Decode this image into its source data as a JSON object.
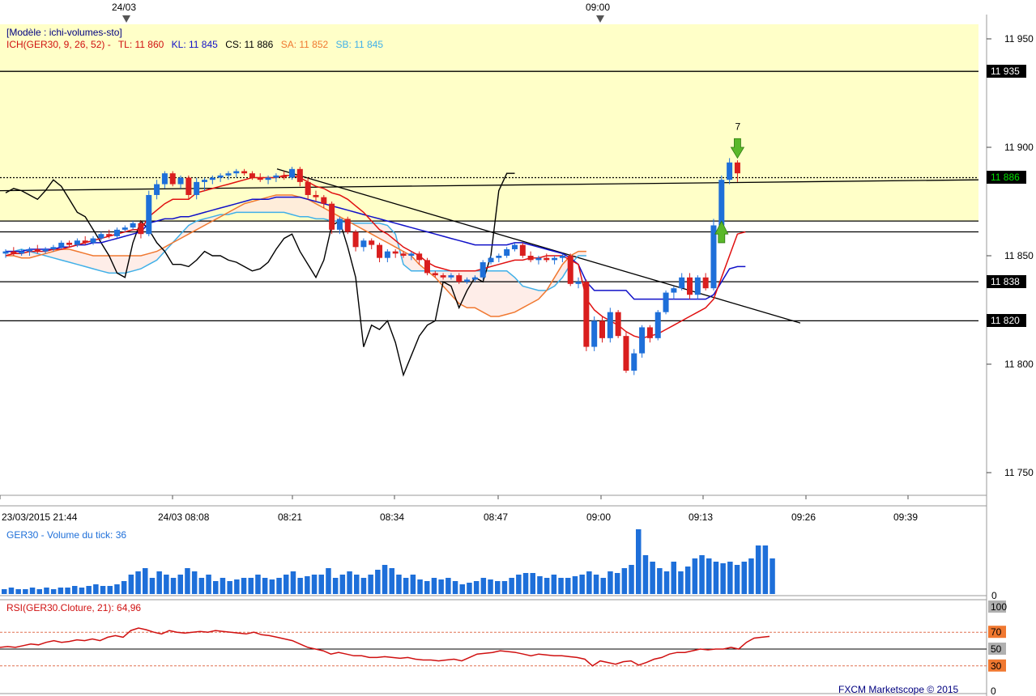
{
  "header": {
    "date_marker": "24/03",
    "time_marker": "09:00"
  },
  "legend": {
    "template": "[Modèle : ichi-volumes-sto]",
    "ich": "ICH(GER30, 9, 26, 52) -",
    "tl": "TL: 11 860",
    "kl": "KL: 11 845",
    "cs": "CS: 11 886",
    "sa": "SA: 11 852",
    "sb": "SB: 11 845"
  },
  "price_axis": {
    "ticks": [
      "11 950",
      "11 900",
      "11 850",
      "11 800",
      "11 750"
    ],
    "tick_values": [
      11950,
      11900,
      11850,
      11800,
      11750
    ],
    "label_11935": "11 935",
    "label_11886": "11 886",
    "label_11838": "11 838",
    "label_11820": "11 820"
  },
  "time_axis": {
    "labels": [
      "23/03/2015 21:44",
      "24/03 08:08",
      "08:21",
      "08:34",
      "08:47",
      "09:00",
      "09:13",
      "09:26",
      "09:39"
    ]
  },
  "volume_panel": {
    "title": "GER30 - Volume du tick: 36",
    "zero_label": "0"
  },
  "rsi_panel": {
    "title": "RSI(GER30.Cloture, 21): 64,96",
    "levels": [
      "100",
      "70",
      "50",
      "30",
      "0"
    ]
  },
  "footer": {
    "copyright": "FXCM Marketscope © 2015"
  },
  "signal": {
    "count_label": "7"
  },
  "colors": {
    "bull": "#1e6fd9",
    "bear": "#d91e1e",
    "tenkan": "#e01010",
    "kijun": "#1010c8",
    "chikou": "#000000",
    "senkou_a": "#f07830",
    "senkou_b": "#40b0e8",
    "highlight_zone": "#ffffc8"
  },
  "chart_data": [
    {
      "type": "candlestick",
      "title": "ICH(GER30, 9, 26, 52)",
      "ylim": [
        11740,
        11960
      ],
      "horizontal_levels": [
        11935,
        11866,
        11861,
        11838,
        11820
      ],
      "current_price": 11886,
      "ohlc": [
        [
          11851,
          11853,
          11849,
          11852
        ],
        [
          11852,
          11854,
          11850,
          11851
        ],
        [
          11851,
          11853,
          11850,
          11852
        ],
        [
          11852,
          11854,
          11850,
          11853
        ],
        [
          11853,
          11855,
          11851,
          11852
        ],
        [
          11852,
          11854,
          11851,
          11853
        ],
        [
          11853,
          11855,
          11852,
          11854
        ],
        [
          11854,
          11857,
          11853,
          11856
        ],
        [
          11856,
          11857,
          11854,
          11855
        ],
        [
          11855,
          11858,
          11854,
          11857
        ],
        [
          11857,
          11859,
          11855,
          11856
        ],
        [
          11856,
          11859,
          11855,
          11858
        ],
        [
          11858,
          11861,
          11857,
          11860
        ],
        [
          11860,
          11862,
          11858,
          11859
        ],
        [
          11859,
          11863,
          11858,
          11862
        ],
        [
          11862,
          11864,
          11861,
          11863
        ],
        [
          11863,
          11866,
          11862,
          11865
        ],
        [
          11865,
          11866,
          11858,
          11860
        ],
        [
          11860,
          11880,
          11859,
          11878
        ],
        [
          11878,
          11885,
          11876,
          11883
        ],
        [
          11883,
          11889,
          11881,
          11888
        ],
        [
          11888,
          11889,
          11882,
          11883
        ],
        [
          11883,
          11887,
          11881,
          11886
        ],
        [
          11886,
          11887,
          11876,
          11878
        ],
        [
          11878,
          11886,
          11876,
          11884
        ],
        [
          11884,
          11886,
          11880,
          11885
        ],
        [
          11885,
          11887,
          11883,
          11886
        ],
        [
          11886,
          11888,
          11884,
          11887
        ],
        [
          11887,
          11889,
          11885,
          11888
        ],
        [
          11888,
          11890,
          11886,
          11889
        ],
        [
          11889,
          11890,
          11887,
          11888
        ],
        [
          11888,
          11889,
          11885,
          11886
        ],
        [
          11886,
          11888,
          11884,
          11885
        ],
        [
          11885,
          11887,
          11883,
          11886
        ],
        [
          11886,
          11888,
          11884,
          11887
        ],
        [
          11887,
          11889,
          11885,
          11886
        ],
        [
          11886,
          11891,
          11885,
          11890
        ],
        [
          11890,
          11891,
          11882,
          11884
        ],
        [
          11884,
          11886,
          11876,
          11878
        ],
        [
          11878,
          11880,
          11875,
          11877
        ],
        [
          11877,
          11878,
          11872,
          11874
        ],
        [
          11874,
          11875,
          11860,
          11862
        ],
        [
          11862,
          11868,
          11860,
          11867
        ],
        [
          11867,
          11868,
          11860,
          11861
        ],
        [
          11861,
          11862,
          11852,
          11854
        ],
        [
          11854,
          11858,
          11852,
          11857
        ],
        [
          11857,
          11858,
          11853,
          11855
        ],
        [
          11855,
          11856,
          11847,
          11849
        ],
        [
          11849,
          11853,
          11847,
          11852
        ],
        [
          11852,
          11853,
          11849,
          11851
        ],
        [
          11851,
          11852,
          11849,
          11850
        ],
        [
          11850,
          11852,
          11848,
          11851
        ],
        [
          11851,
          11852,
          11846,
          11848
        ],
        [
          11848,
          11849,
          11841,
          11842
        ],
        [
          11842,
          11843,
          11840,
          11841
        ],
        [
          11841,
          11842,
          11839,
          11840
        ],
        [
          11840,
          11842,
          11839,
          11841
        ],
        [
          11841,
          11842,
          11837,
          11838
        ],
        [
          11838,
          11840,
          11837,
          11839
        ],
        [
          11839,
          11841,
          11838,
          11840
        ],
        [
          11840,
          11848,
          11839,
          11847
        ],
        [
          11847,
          11850,
          11846,
          11849
        ],
        [
          11849,
          11851,
          11847,
          11850
        ],
        [
          11850,
          11854,
          11849,
          11853
        ],
        [
          11853,
          11856,
          11852,
          11855
        ],
        [
          11855,
          11856,
          11849,
          11850
        ],
        [
          11850,
          11852,
          11847,
          11848
        ],
        [
          11848,
          11850,
          11846,
          11849
        ],
        [
          11849,
          11851,
          11847,
          11848
        ],
        [
          11848,
          11850,
          11846,
          11849
        ],
        [
          11849,
          11851,
          11847,
          11850
        ],
        [
          11850,
          11851,
          11836,
          11837
        ],
        [
          11837,
          11840,
          11835,
          11838
        ],
        [
          11838,
          11839,
          11806,
          11808
        ],
        [
          11808,
          11822,
          11806,
          11820
        ],
        [
          11820,
          11822,
          11810,
          11812
        ],
        [
          11812,
          11826,
          11810,
          11824
        ],
        [
          11824,
          11825,
          11812,
          11813
        ],
        [
          11813,
          11815,
          11796,
          11797
        ],
        [
          11797,
          11807,
          11795,
          11805
        ],
        [
          11805,
          11818,
          11803,
          11817
        ],
        [
          11817,
          11818,
          11810,
          11812
        ],
        [
          11812,
          11825,
          11811,
          11824
        ],
        [
          11824,
          11834,
          11823,
          11833
        ],
        [
          11833,
          11836,
          11830,
          11835
        ],
        [
          11835,
          11842,
          11834,
          11840
        ],
        [
          11840,
          11842,
          11830,
          11832
        ],
        [
          11832,
          11841,
          11830,
          11840
        ],
        [
          11840,
          11842,
          11834,
          11835
        ],
        [
          11835,
          11867,
          11834,
          11864
        ],
        [
          11864,
          11887,
          11862,
          11885
        ],
        [
          11885,
          11895,
          11883,
          11893
        ],
        [
          11893,
          11894,
          11884,
          11888
        ]
      ],
      "tenkan": [
        11850,
        11851,
        11851,
        11852,
        11852,
        11852,
        11853,
        11853,
        11854,
        11855,
        11856,
        11857,
        11858,
        11859,
        11860,
        11861,
        11862,
        11862,
        11868,
        11871,
        11874,
        11876,
        11876,
        11876,
        11879,
        11880,
        11881,
        11882,
        11883,
        11884,
        11885,
        11886,
        11886,
        11886,
        11886,
        11887,
        11887,
        11886,
        11884,
        11882,
        11881,
        11879,
        11878,
        11876,
        11873,
        11870,
        11866,
        11862,
        11860,
        11857,
        11854,
        11852,
        11850,
        11847,
        11845,
        11844,
        11843,
        11843,
        11843,
        11843,
        11844,
        11845,
        11846,
        11847,
        11848,
        11848,
        11849,
        11849,
        11850,
        11850,
        11850,
        11848,
        11846,
        11830,
        11825,
        11822,
        11820,
        11818,
        11815,
        11813,
        11812,
        11813,
        11814,
        11816,
        11818,
        11820,
        11822,
        11824,
        11826,
        11830,
        11840,
        11850,
        11860,
        11861
      ],
      "kijun": [
        11852,
        11852,
        11852,
        11853,
        11853,
        11853,
        11853,
        11854,
        11854,
        11855,
        11855,
        11856,
        11856,
        11857,
        11858,
        11859,
        11860,
        11861,
        11865,
        11866,
        11867,
        11867,
        11868,
        11868,
        11869,
        11870,
        11871,
        11872,
        11873,
        11874,
        11875,
        11876,
        11876,
        11876,
        11877,
        11877,
        11877,
        11877,
        11876,
        11875,
        11874,
        11873,
        11872,
        11871,
        11870,
        11869,
        11868,
        11867,
        11866,
        11865,
        11864,
        11863,
        11862,
        11861,
        11860,
        11859,
        11858,
        11857,
        11856,
        11855,
        11855,
        11855,
        11855,
        11855,
        11856,
        11856,
        11855,
        11854,
        11853,
        11852,
        11851,
        11849,
        11846,
        11838,
        11834,
        11834,
        11834,
        11834,
        11834,
        11830,
        11830,
        11830,
        11830,
        11830,
        11830,
        11830,
        11830,
        11830,
        11830,
        11832,
        11838,
        11844,
        11845,
        11845
      ],
      "senkou_a": [
        11850,
        11850,
        11849,
        11849,
        11850,
        11851,
        11852,
        11853,
        11853,
        11852,
        11851,
        11850,
        11850,
        11850,
        11850,
        11850,
        11850,
        11850,
        11851,
        11852,
        11854,
        11856,
        11858,
        11860,
        11862,
        11864,
        11866,
        11868,
        11870,
        11872,
        11874,
        11875,
        11876,
        11877,
        11878,
        11878,
        11878,
        11877,
        11876,
        11874,
        11872,
        11870,
        11868,
        11866,
        11864,
        11862,
        11860,
        11858,
        11856,
        11854,
        11852,
        11850,
        11846,
        11843,
        11840,
        11836,
        11832,
        11828,
        11826,
        11826,
        11824,
        11822,
        11822,
        11823,
        11824,
        11826,
        11828,
        11830,
        11834,
        11840,
        11846,
        11850,
        11852,
        11852
      ],
      "senkou_b": [
        11852,
        11852,
        11853,
        11852,
        11851,
        11850,
        11849,
        11848,
        11847,
        11846,
        11845,
        11844,
        11843,
        11842,
        11842,
        11842,
        11843,
        11844,
        11846,
        11848,
        11852,
        11856,
        11860,
        11864,
        11866,
        11867,
        11868,
        11869,
        11869,
        11870,
        11870,
        11870,
        11870,
        11870,
        11870,
        11870,
        11869,
        11868,
        11868,
        11867,
        11867,
        11866,
        11866,
        11865,
        11865,
        11865,
        11865,
        11865,
        11864,
        11860,
        11846,
        11843,
        11843,
        11843,
        11843,
        11843,
        11843,
        11843,
        11843,
        11843,
        11843,
        11843,
        11843,
        11843,
        11840,
        11836,
        11835,
        11834,
        11834,
        11836,
        11840,
        11846,
        11850,
        11850
      ],
      "chikou": [
        11879,
        11881,
        11880,
        11878,
        11876,
        11880,
        11885,
        11882,
        11876,
        11870,
        11868,
        11862,
        11856,
        11850,
        11842,
        11840,
        11856,
        11866,
        11862,
        11856,
        11852,
        11846,
        11846,
        11845,
        11848,
        11852,
        11850,
        11850,
        11848,
        11847,
        11845,
        11843,
        11844,
        11847,
        11853,
        11858,
        11860,
        11852,
        11846,
        11840,
        11848,
        11864,
        11866,
        11854,
        11840,
        11808,
        11818,
        11816,
        11820,
        11810,
        11795,
        11804,
        11813,
        11818,
        11820,
        11838,
        11836,
        11826,
        11834,
        11840,
        11838,
        11850,
        11880,
        11888,
        11888
      ]
    },
    {
      "type": "bar",
      "title": "GER30 - Volume du tick: 36",
      "values": [
        3,
        4,
        3,
        3,
        4,
        3,
        4,
        3,
        4,
        4,
        5,
        4,
        5,
        6,
        5,
        5,
        6,
        8,
        12,
        14,
        16,
        10,
        14,
        12,
        10,
        12,
        16,
        14,
        10,
        12,
        8,
        10,
        8,
        9,
        10,
        10,
        12,
        10,
        9,
        10,
        12,
        14,
        10,
        11,
        12,
        12,
        16,
        10,
        12,
        14,
        12,
        10,
        12,
        15,
        18,
        16,
        12,
        10,
        12,
        9,
        8,
        10,
        9,
        10,
        8,
        6,
        7,
        8,
        10,
        9,
        8,
        8,
        10,
        12,
        13,
        13,
        11,
        10,
        12,
        10,
        10,
        11,
        12,
        14,
        12,
        10,
        14,
        13,
        16,
        18,
        40,
        24,
        20,
        16,
        14,
        20,
        14,
        17,
        22,
        24,
        22,
        20,
        19,
        20,
        18,
        20,
        22,
        30,
        30,
        22
      ],
      "ylim": [
        0,
        40
      ]
    },
    {
      "type": "line",
      "title": "RSI(GER30.Cloture, 21): 64,96",
      "ylim": [
        0,
        100
      ],
      "reference_levels": [
        70,
        50,
        30
      ],
      "values": [
        52,
        53,
        52,
        54,
        56,
        55,
        58,
        60,
        58,
        59,
        61,
        60,
        62,
        60,
        64,
        66,
        64,
        72,
        75,
        73,
        70,
        68,
        72,
        70,
        69,
        70,
        71,
        70,
        72,
        71,
        70,
        69,
        68,
        70,
        67,
        66,
        64,
        62,
        60,
        56,
        52,
        50,
        48,
        44,
        46,
        44,
        42,
        42,
        40,
        40,
        41,
        40,
        39,
        40,
        38,
        37,
        37,
        36,
        37,
        38,
        36,
        40,
        44,
        45,
        46,
        48,
        47,
        46,
        44,
        42,
        44,
        43,
        42,
        42,
        41,
        40,
        38,
        30,
        36,
        34,
        32,
        35,
        36,
        31,
        34,
        38,
        40,
        44,
        46,
        46,
        48,
        50,
        49,
        50,
        50,
        52,
        50,
        58,
        63,
        64,
        65
      ]
    }
  ]
}
